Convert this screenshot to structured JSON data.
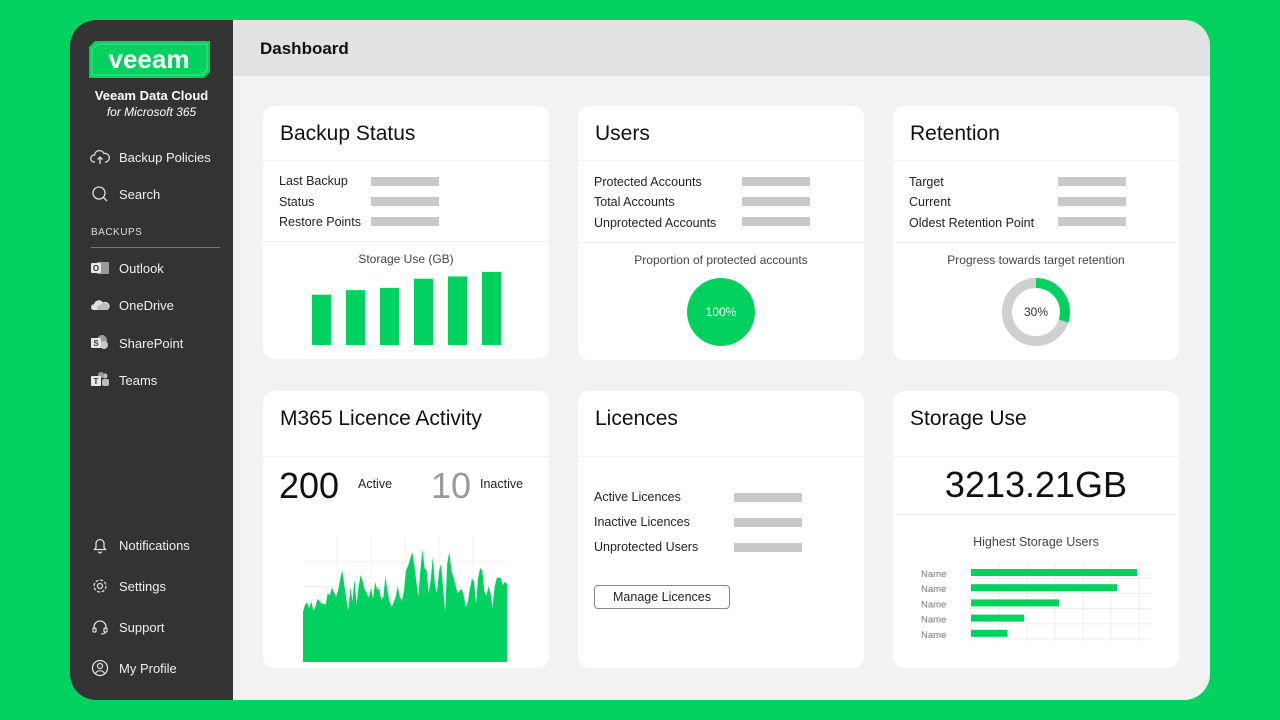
{
  "brand": {
    "logo_text": "veeam",
    "product_name": "Veeam Data Cloud",
    "product_sub": "for Microsoft 365",
    "color": "#00d15f"
  },
  "header": {
    "title": "Dashboard"
  },
  "sidebar": {
    "top_items": [
      {
        "label": "Backup Policies",
        "icon": "cloud-upload-icon"
      },
      {
        "label": "Search",
        "icon": "search-icon"
      }
    ],
    "section_label": "BACKUPS",
    "backup_items": [
      {
        "label": "Outlook",
        "icon": "outlook-icon"
      },
      {
        "label": "OneDrive",
        "icon": "onedrive-icon"
      },
      {
        "label": "SharePoint",
        "icon": "sharepoint-icon"
      },
      {
        "label": "Teams",
        "icon": "teams-icon"
      }
    ],
    "bottom_items": [
      {
        "label": "Notifications",
        "icon": "bell-icon"
      },
      {
        "label": "Settings",
        "icon": "gear-icon"
      },
      {
        "label": "Support",
        "icon": "headset-icon"
      },
      {
        "label": "My Profile",
        "icon": "user-icon"
      }
    ]
  },
  "backup_status": {
    "title": "Backup Status",
    "rows": [
      "Last Backup",
      "Status",
      "Restore Points"
    ],
    "chart_title": "Storage Use (GB)"
  },
  "users": {
    "title": "Users",
    "rows": [
      "Protected Accounts",
      "Total Accounts",
      "Unprotected Accounts"
    ],
    "chart_title": "Proportion of protected accounts",
    "percent_label": "100%",
    "percent": 100
  },
  "retention": {
    "title": "Retention",
    "rows": [
      "Target",
      "Current",
      "Oldest Retention Point"
    ],
    "chart_title": "Progress towards target retention",
    "percent_label": "30%",
    "percent": 30
  },
  "licence_activity": {
    "title": "M365 Licence Activity",
    "active_count": "200",
    "active_label": "Active",
    "inactive_count": "10",
    "inactive_label": "Inactive"
  },
  "licences": {
    "title": "Licences",
    "rows": [
      "Active Licences",
      "Inactive Licences",
      "Unprotected Users"
    ],
    "button": "Manage Licences"
  },
  "storage_use": {
    "title": "Storage Use",
    "total": "3213.21GB",
    "chart_title": "Highest Storage Users"
  },
  "chart_data": [
    {
      "type": "bar",
      "title": "Storage Use (GB)",
      "categories": [
        "",
        "",
        "",
        "",
        "",
        ""
      ],
      "values": [
        44,
        48,
        50,
        58,
        60,
        64
      ],
      "ylim": [
        0,
        70
      ],
      "color": "#00d15f"
    },
    {
      "type": "area",
      "title": "",
      "x": [
        0,
        1,
        2,
        3,
        4,
        5,
        6,
        7,
        8,
        9,
        10,
        11,
        12,
        13,
        14,
        15,
        16,
        17,
        18,
        19,
        20,
        21,
        22,
        23,
        24,
        25,
        26,
        27,
        28,
        29,
        30,
        31,
        32,
        33,
        34,
        35,
        36,
        37,
        38,
        39,
        40,
        41,
        42,
        43,
        44,
        45,
        46,
        47,
        48,
        49,
        50,
        51,
        52,
        53,
        54,
        55,
        56,
        57,
        58,
        59,
        60,
        61,
        62,
        63,
        64,
        65,
        66,
        67,
        68,
        69,
        70,
        71,
        72,
        73,
        74,
        75,
        76,
        77,
        78,
        79,
        80,
        81,
        82,
        83,
        84,
        85,
        86,
        87,
        88,
        89,
        90,
        91,
        92,
        93,
        94,
        95,
        96,
        97,
        98,
        99
      ],
      "values": [
        44,
        50,
        52,
        47,
        53,
        45,
        48,
        55,
        53,
        51,
        51,
        50,
        60,
        58,
        65,
        61,
        57,
        62,
        72,
        80,
        68,
        55,
        45,
        65,
        53,
        72,
        50,
        66,
        76,
        70,
        63,
        60,
        56,
        65,
        55,
        70,
        63,
        64,
        54,
        57,
        75,
        62,
        53,
        48,
        52,
        57,
        66,
        57,
        53,
        62,
        80,
        84,
        90,
        96,
        85,
        70,
        57,
        82,
        98,
        82,
        80,
        60,
        72,
        92,
        68,
        60,
        79,
        86,
        64,
        44,
        86,
        96,
        80,
        74,
        67,
        60,
        62,
        64,
        58,
        48,
        52,
        64,
        73,
        70,
        51,
        74,
        82,
        80,
        62,
        58,
        66,
        60,
        47,
        66,
        73,
        74,
        73,
        67,
        70,
        68
      ],
      "ylim": [
        0,
        110
      ],
      "color": "#00d15f"
    },
    {
      "type": "bar",
      "title": "Highest Storage Users",
      "categories": [
        "Name",
        "Name",
        "Name",
        "Name",
        "Name"
      ],
      "values": [
        100,
        88,
        53,
        32,
        22
      ],
      "color": "#00d15f"
    }
  ]
}
